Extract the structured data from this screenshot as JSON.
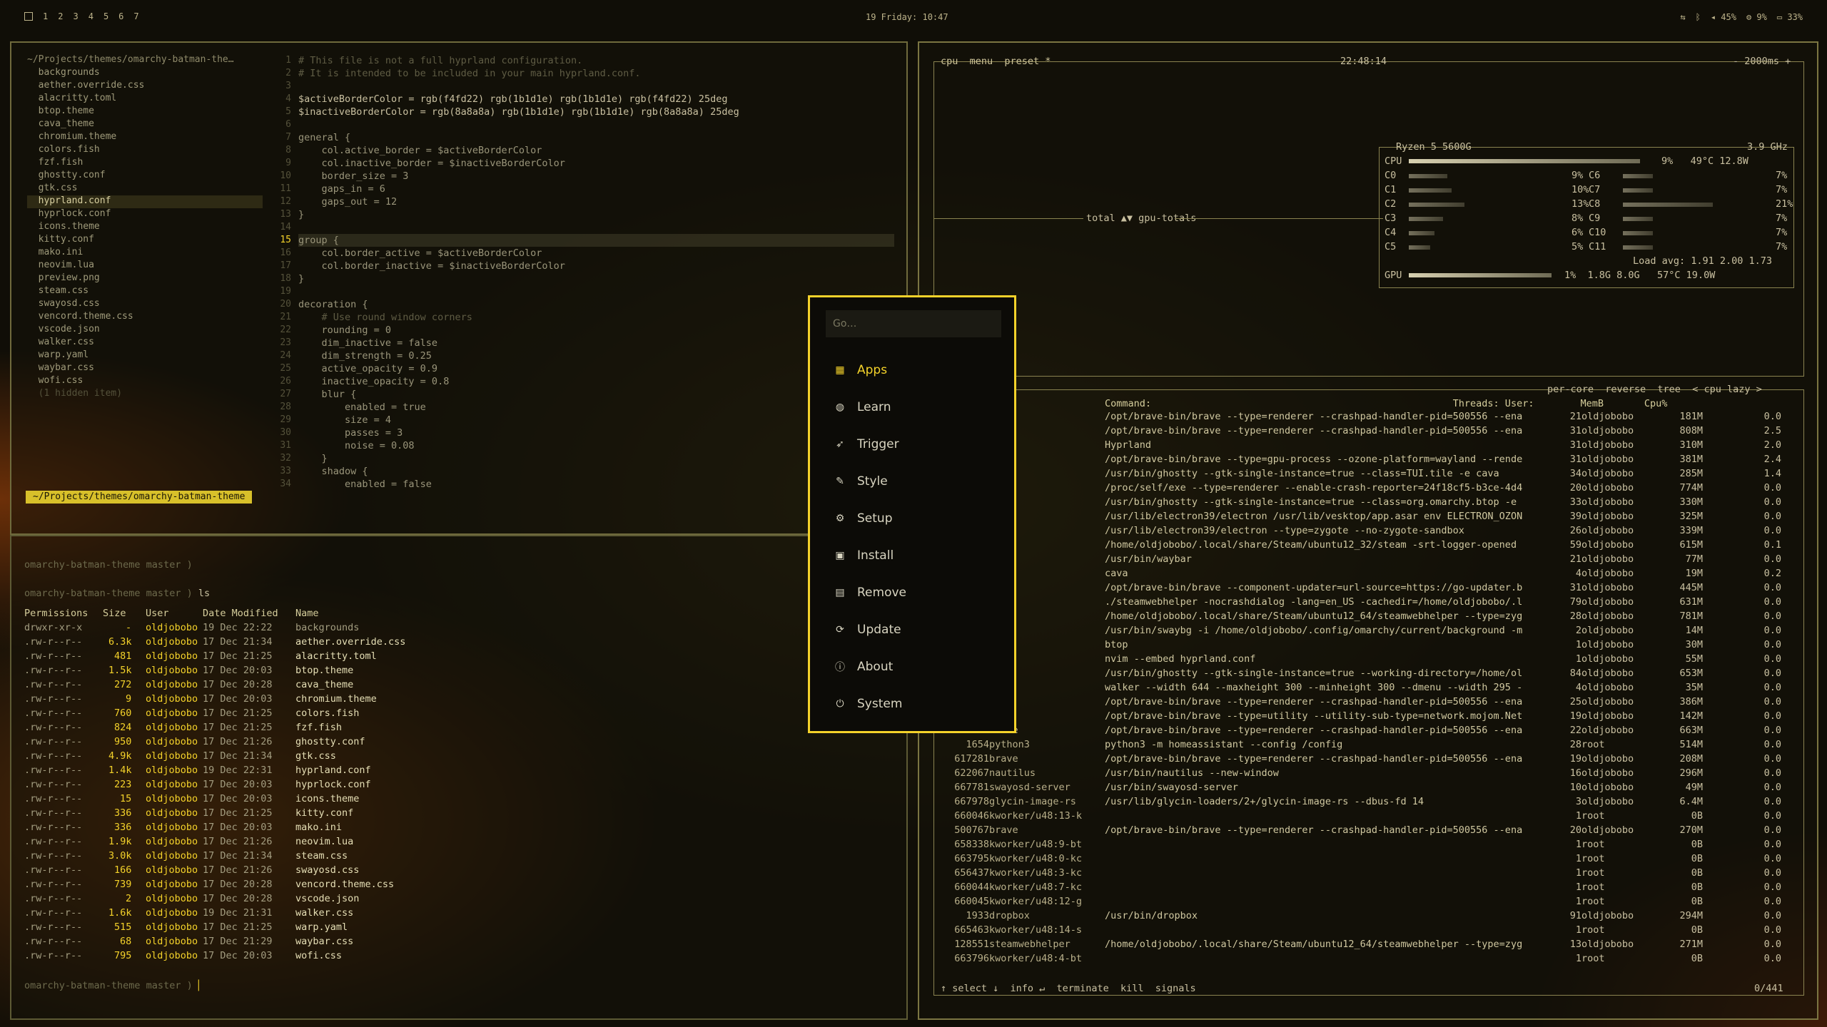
{
  "topbar": {
    "workspaces": [
      "1",
      "2",
      "3",
      "4",
      "5",
      "6",
      "7"
    ],
    "clock": "19 Friday: 10:47",
    "tray": [
      "45%",
      "9%",
      "33%"
    ]
  },
  "editor": {
    "tree": [
      "~/Projects/themes/omarchy-batman-the…",
      "  backgrounds",
      "  aether.override.css",
      "  alacritty.toml",
      "  btop.theme",
      "  cava_theme",
      "  chromium.theme",
      "  colors.fish",
      "  fzf.fish",
      "  ghostty.conf",
      "  gtk.css",
      "  hyprland.conf",
      "  hyprlock.conf",
      "  icons.theme",
      "  kitty.conf",
      "  mako.ini",
      "  neovim.lua",
      "  preview.png",
      "  steam.css",
      "  swayosd.css",
      "  vencord.theme.css",
      "  vscode.json",
      "  walker.css",
      "  warp.yaml",
      "  waybar.css",
      "  wofi.css",
      "  (1 hidden item)"
    ],
    "code": [
      "# This file is not a full hyprland configuration.",
      "# It is intended to be included in your main hyprland.conf.",
      "",
      "$activeBorderColor = rgb(f4fd22) rgb(1b1d1e) rgb(1b1d1e) rgb(f4fd22) 25deg",
      "$inactiveBorderColor = rgb(8a8a8a) rgb(1b1d1e) rgb(1b1d1e) rgb(8a8a8a) 25deg",
      "",
      "general {",
      "    col.active_border = $activeBorderColor",
      "    col.inactive_border = $inactiveBorderColor",
      "    border_size = 3",
      "    gaps_in = 6",
      "    gaps_out = 12",
      "}",
      "",
      "group {",
      "    col.border_active = $activeBorderColor",
      "    col.border_inactive = $inactiveBorderColor",
      "}",
      "",
      "decoration {",
      "    # Use round window corners",
      "    rounding = 0",
      "    dim_inactive = false",
      "    dim_strength = 0.25",
      "    active_opacity = 0.9",
      "    inactive_opacity = 0.8",
      "    blur {",
      "        enabled = true",
      "        size = 4",
      "        passes = 3",
      "        noise = 0.08",
      "    }",
      "    shadow {",
      "        enabled = false"
    ],
    "status": "~/Projects/themes/omarchy-batman-theme"
  },
  "terminal": {
    "prompt1": "omarchy-batman-theme master )",
    "prompt2": "omarchy-batman-theme master ) ls",
    "headers": [
      "Permissions",
      "Size",
      "User",
      "Date Modified",
      "Name"
    ],
    "rows": [
      [
        "drwxr-xr-x",
        "-",
        "oldjobobo",
        "19 Dec 22:22",
        "backgrounds"
      ],
      [
        ".rw-r--r--",
        "6.3k",
        "oldjobobo",
        "17 Dec 21:34",
        "aether.override.css"
      ],
      [
        ".rw-r--r--",
        "481",
        "oldjobobo",
        "17 Dec 21:25",
        "alacritty.toml"
      ],
      [
        ".rw-r--r--",
        "1.5k",
        "oldjobobo",
        "17 Dec 20:03",
        "btop.theme"
      ],
      [
        ".rw-r--r--",
        "272",
        "oldjobobo",
        "17 Dec 20:28",
        "cava_theme"
      ],
      [
        ".rw-r--r--",
        "9",
        "oldjobobo",
        "17 Dec 20:03",
        "chromium.theme"
      ],
      [
        ".rw-r--r--",
        "760",
        "oldjobobo",
        "17 Dec 21:25",
        "colors.fish"
      ],
      [
        ".rw-r--r--",
        "824",
        "oldjobobo",
        "17 Dec 21:25",
        "fzf.fish"
      ],
      [
        ".rw-r--r--",
        "950",
        "oldjobobo",
        "17 Dec 21:26",
        "ghostty.conf"
      ],
      [
        ".rw-r--r--",
        "4.9k",
        "oldjobobo",
        "17 Dec 21:34",
        "gtk.css"
      ],
      [
        ".rw-r--r--",
        "1.4k",
        "oldjobobo",
        "19 Dec 22:31",
        "hyprland.conf"
      ],
      [
        ".rw-r--r--",
        "223",
        "oldjobobo",
        "17 Dec 20:03",
        "hyprlock.conf"
      ],
      [
        ".rw-r--r--",
        "15",
        "oldjobobo",
        "17 Dec 20:03",
        "icons.theme"
      ],
      [
        ".rw-r--r--",
        "336",
        "oldjobobo",
        "17 Dec 21:25",
        "kitty.conf"
      ],
      [
        ".rw-r--r--",
        "336",
        "oldjobobo",
        "17 Dec 20:03",
        "mako.ini"
      ],
      [
        ".rw-r--r--",
        "1.9k",
        "oldjobobo",
        "17 Dec 21:26",
        "neovim.lua"
      ],
      [
        ".rw-r--r--",
        "3.0k",
        "oldjobobo",
        "17 Dec 21:34",
        "steam.css"
      ],
      [
        ".rw-r--r--",
        "166",
        "oldjobobo",
        "17 Dec 21:26",
        "swayosd.css"
      ],
      [
        ".rw-r--r--",
        "739",
        "oldjobobo",
        "17 Dec 20:28",
        "vencord.theme.css"
      ],
      [
        ".rw-r--r--",
        "2",
        "oldjobobo",
        "17 Dec 20:28",
        "vscode.json"
      ],
      [
        ".rw-r--r--",
        "1.6k",
        "oldjobobo",
        "19 Dec 21:31",
        "walker.css"
      ],
      [
        ".rw-r--r--",
        "515",
        "oldjobobo",
        "17 Dec 21:25",
        "warp.yaml"
      ],
      [
        ".rw-r--r--",
        "68",
        "oldjobobo",
        "17 Dec 21:29",
        "waybar.css"
      ],
      [
        ".rw-r--r--",
        "795",
        "oldjobobo",
        "17 Dec 20:03",
        "wofi.css"
      ]
    ],
    "prompt3": "omarchy-batman-theme master )"
  },
  "btop": {
    "tabs": "cpu  menu  preset *",
    "time": "22:48:14",
    "interval": "- 2000ms +",
    "gpu_totals": "total ▲▼ gpu-totals",
    "cpu_model": "Ryzen 5 5600G",
    "freq": "3.9 GHz",
    "cpu_line": "9%   49°C 12.8W",
    "cores_left": [
      [
        "C0",
        "9%"
      ],
      [
        "C1",
        "10%"
      ],
      [
        "C2",
        "13%"
      ],
      [
        "C3",
        "8%"
      ],
      [
        "C4",
        "6%"
      ],
      [
        "C5",
        "5%"
      ]
    ],
    "cores_right": [
      [
        "C6",
        "7%"
      ],
      [
        "C7",
        "7%"
      ],
      [
        "C8",
        "21%"
      ],
      [
        "C9",
        "7%"
      ],
      [
        "C10",
        "7%"
      ],
      [
        "C11",
        "7%"
      ]
    ],
    "load": "Load avg: 1.91 2.00 1.73",
    "gpu_line": "1%  1.8G 8.0G   57°C 19.0W",
    "proc_tabs": "per-core  reverse  tree  < cpu lazy >",
    "proc_headers": "Command:                                                    Threads: User:        MemB       Cpu%",
    "procs": [
      [
        "",
        "",
        "/opt/brave-bin/brave --type=renderer --crashpad-handler-pid=500556 --ena",
        "21",
        "oldjobobo",
        "181M",
        "0.0"
      ],
      [
        "",
        "",
        "/opt/brave-bin/brave --type=renderer --crashpad-handler-pid=500556 --ena",
        "31",
        "oldjobobo",
        "808M",
        "2.5"
      ],
      [
        "",
        "",
        "Hyprland",
        "31",
        "oldjobobo",
        "310M",
        "2.0"
      ],
      [
        "",
        "",
        "/opt/brave-bin/brave --type=gpu-process --ozone-platform=wayland --rende",
        "31",
        "oldjobobo",
        "381M",
        "2.4"
      ],
      [
        "",
        "",
        "/usr/bin/ghostty --gtk-single-instance=true --class=TUI.tile -e cava",
        "34",
        "oldjobobo",
        "285M",
        "1.4"
      ],
      [
        "",
        "",
        "/proc/self/exe --type=renderer --enable-crash-reporter=24f18cf5-b3ce-4d4",
        "20",
        "oldjobobo",
        "774M",
        "0.0"
      ],
      [
        "",
        "",
        "/usr/bin/ghostty --gtk-single-instance=true --class=org.omarchy.btop -e",
        "33",
        "oldjobobo",
        "330M",
        "0.0"
      ],
      [
        "",
        "",
        "/usr/lib/electron39/electron /usr/lib/vesktop/app.asar env ELECTRON_OZON",
        "39",
        "oldjobobo",
        "325M",
        "0.0"
      ],
      [
        "",
        "",
        "/usr/lib/electron39/electron --type=zygote --no-zygote-sandbox",
        "26",
        "oldjobobo",
        "339M",
        "0.0"
      ],
      [
        "",
        "",
        "/home/oldjobobo/.local/share/Steam/ubuntu12_32/steam -srt-logger-opened",
        "59",
        "oldjobobo",
        "615M",
        "0.1"
      ],
      [
        "",
        "",
        "/usr/bin/waybar",
        "21",
        "oldjobobo",
        "77M",
        "0.0"
      ],
      [
        "",
        "",
        "cava",
        "4",
        "oldjobobo",
        "19M",
        "0.2"
      ],
      [
        "",
        "",
        "/opt/brave-bin/brave --component-updater=url-source=https://go-updater.b",
        "31",
        "oldjobobo",
        "445M",
        "0.0"
      ],
      [
        "",
        "",
        "./steamwebhelper -nocrashdialog -lang=en_US -cachedir=/home/oldjobobo/.l",
        "79",
        "oldjobobo",
        "631M",
        "0.0"
      ],
      [
        "",
        "",
        "/home/oldjobobo/.local/share/Steam/ubuntu12_64/steamwebhelper --type=zyg",
        "28",
        "oldjobobo",
        "781M",
        "0.0"
      ],
      [
        "",
        "",
        "/usr/bin/swaybg -i /home/oldjobobo/.config/omarchy/current/background -m",
        "2",
        "oldjobobo",
        "14M",
        "0.0"
      ],
      [
        "",
        "",
        "btop",
        "1",
        "oldjobobo",
        "30M",
        "0.0"
      ],
      [
        "",
        "",
        "nvim --embed hyprland.conf",
        "1",
        "oldjobobo",
        "55M",
        "0.0"
      ],
      [
        "",
        "",
        "/usr/bin/ghostty --gtk-single-instance=true --working-directory=/home/ol",
        "84",
        "oldjobobo",
        "653M",
        "0.0"
      ],
      [
        "",
        "",
        "walker --width 644 --maxheight 300 --minheight 300 --dmenu --width 295 -",
        "4",
        "oldjobobo",
        "35M",
        "0.0"
      ],
      [
        "",
        "",
        "/opt/brave-bin/brave --type=renderer --crashpad-handler-pid=500556 --ena",
        "25",
        "oldjobobo",
        "386M",
        "0.0"
      ],
      [
        "",
        "",
        "/opt/brave-bin/brave --type=utility --utility-sub-type=network.mojom.Net",
        "19",
        "oldjobobo",
        "142M",
        "0.0"
      ],
      [
        "500722",
        "brave",
        "/opt/brave-bin/brave --type=renderer --crashpad-handler-pid=500556 --ena",
        "22",
        "oldjobobo",
        "663M",
        "0.0"
      ],
      [
        "1654",
        "python3",
        "python3 -m homeassistant --config /config",
        "28",
        "root",
        "514M",
        "0.0"
      ],
      [
        "617281",
        "brave",
        "/opt/brave-bin/brave --type=renderer --crashpad-handler-pid=500556 --ena",
        "19",
        "oldjobobo",
        "208M",
        "0.0"
      ],
      [
        "622067",
        "nautilus",
        "/usr/bin/nautilus --new-window",
        "16",
        "oldjobobo",
        "296M",
        "0.0"
      ],
      [
        "667781",
        "swayosd-server",
        "/usr/bin/swayosd-server",
        "10",
        "oldjobobo",
        "49M",
        "0.0"
      ],
      [
        "667978",
        "glycin-image-rs",
        "/usr/lib/glycin-loaders/2+/glycin-image-rs --dbus-fd 14",
        "3",
        "oldjobobo",
        "6.4M",
        "0.0"
      ],
      [
        "660046",
        "kworker/u48:13-k",
        "",
        "1",
        "root",
        "0B",
        "0.0"
      ],
      [
        "500767",
        "brave",
        "/opt/brave-bin/brave --type=renderer --crashpad-handler-pid=500556 --ena",
        "20",
        "oldjobobo",
        "270M",
        "0.0"
      ],
      [
        "658338",
        "kworker/u48:9-bt",
        "",
        "1",
        "root",
        "0B",
        "0.0"
      ],
      [
        "663795",
        "kworker/u48:0-kc",
        "",
        "1",
        "root",
        "0B",
        "0.0"
      ],
      [
        "656437",
        "kworker/u48:3-kc",
        "",
        "1",
        "root",
        "0B",
        "0.0"
      ],
      [
        "660044",
        "kworker/u48:7-kc",
        "",
        "1",
        "root",
        "0B",
        "0.0"
      ],
      [
        "660045",
        "kworker/u48:12-g",
        "",
        "1",
        "root",
        "0B",
        "0.0"
      ],
      [
        "1933",
        "dropbox",
        "/usr/bin/dropbox",
        "91",
        "oldjobobo",
        "294M",
        "0.0"
      ],
      [
        "665463",
        "kworker/u48:14-s",
        "",
        "1",
        "root",
        "0B",
        "0.0"
      ],
      [
        "128551",
        "steamwebhelper",
        "/home/oldjobobo/.local/share/Steam/ubuntu12_64/steamwebhelper --type=zyg",
        "13",
        "oldjobobo",
        "271M",
        "0.0"
      ],
      [
        "663796",
        "kworker/u48:4-bt",
        "",
        "1",
        "root",
        "0B",
        "0.0"
      ]
    ],
    "footer": "↑ select ↓  info ↵  terminate  kill  signals",
    "count": "0/441"
  },
  "launcher": {
    "placeholder": "Go…",
    "items": [
      {
        "label": "Apps",
        "icon": "grid-icon"
      },
      {
        "label": "Learn",
        "icon": "brain-icon"
      },
      {
        "label": "Trigger",
        "icon": "rocket-icon"
      },
      {
        "label": "Style",
        "icon": "paintbrush-icon"
      },
      {
        "label": "Setup",
        "icon": "gear-icon"
      },
      {
        "label": "Install",
        "icon": "package-icon"
      },
      {
        "label": "Remove",
        "icon": "trash-icon"
      },
      {
        "label": "Update",
        "icon": "refresh-icon"
      },
      {
        "label": "About",
        "icon": "info-icon"
      },
      {
        "label": "System",
        "icon": "power-icon"
      }
    ]
  }
}
